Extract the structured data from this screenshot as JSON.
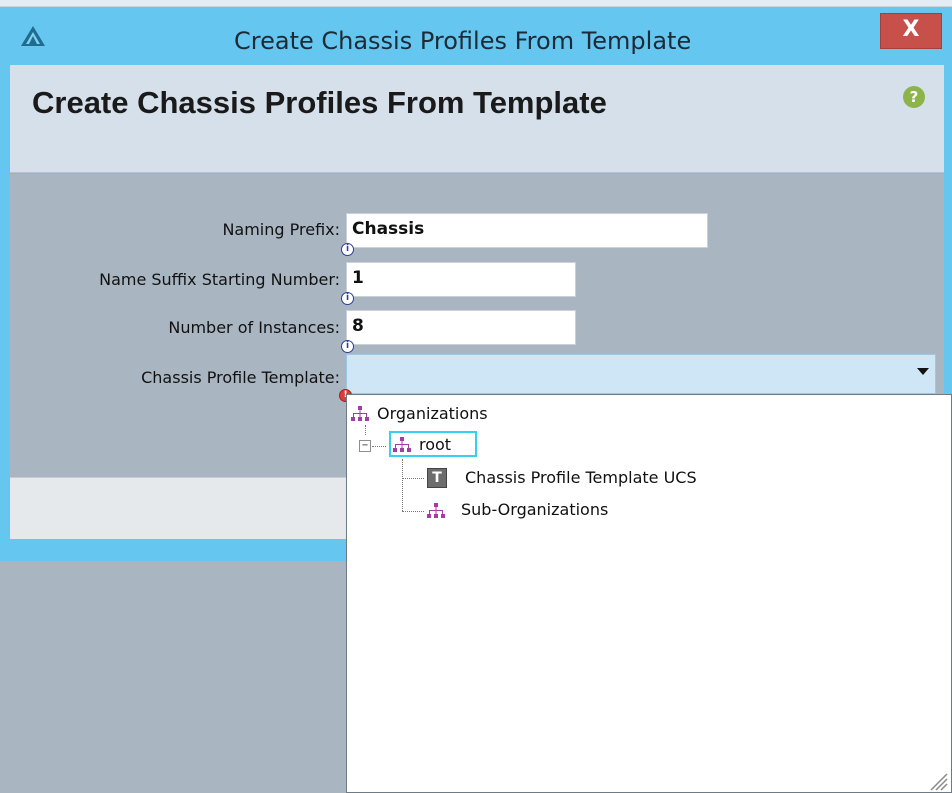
{
  "window": {
    "title": "Create Chassis Profiles From Template",
    "close_label": "X"
  },
  "header": {
    "title": "Create Chassis Profiles From Template",
    "help_symbol": "?"
  },
  "form": {
    "naming_prefix": {
      "label": "Naming Prefix:",
      "value": "Chassis"
    },
    "name_suffix_start": {
      "label": "Name Suffix Starting Number:",
      "value": "1"
    },
    "number_of_instances": {
      "label": "Number of Instances:",
      "value": "8"
    },
    "chassis_profile_template": {
      "label": "Chassis Profile Template:",
      "value": ""
    }
  },
  "icons": {
    "info_symbol": "i",
    "error_symbol": "!"
  },
  "dropdown_tree": {
    "organizations": "Organizations",
    "root": "root",
    "template_icon_letter": "T",
    "template_item": "Chassis Profile Template UCS",
    "sub_organizations": "Sub-Organizations",
    "collapse_symbol": "−"
  },
  "colors": {
    "titlebar": "#65c6f0",
    "header_panel": "#d5e0ea",
    "form_panel": "#a9b6c2",
    "close_button": "#c7514a",
    "help_icon": "#8bb54a",
    "org_icon": "#a23da6",
    "select_field": "#cfe6f7",
    "focus_border": "#35d0ef"
  }
}
